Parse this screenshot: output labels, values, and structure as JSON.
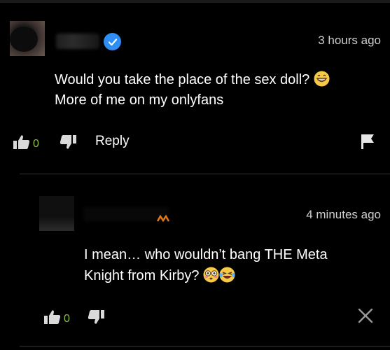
{
  "comments": [
    {
      "time": "3 hours ago",
      "text_line1": "Would you take the place of the sex doll?",
      "text_line2": "More of me on my onlyfans",
      "likes": "0",
      "reply_label": "Reply"
    },
    {
      "time": "4 minutes ago",
      "text_line1": "I mean… who wouldn’t bang THE Meta",
      "text_line2": "Knight from Kirby?",
      "likes": "0"
    }
  ],
  "colors": {
    "background": "#000000",
    "text": "#ffffff",
    "muted": "#cfcfcf",
    "like_count": "#8fbf3f",
    "verified": "#2e8ef3",
    "divider": "#333333"
  },
  "icons": [
    "thumbs-up-icon",
    "thumbs-down-icon",
    "flag-icon",
    "close-icon",
    "verified-badge-icon",
    "grinning-emoji",
    "flushed-emoji",
    "laughing-tears-emoji"
  ]
}
